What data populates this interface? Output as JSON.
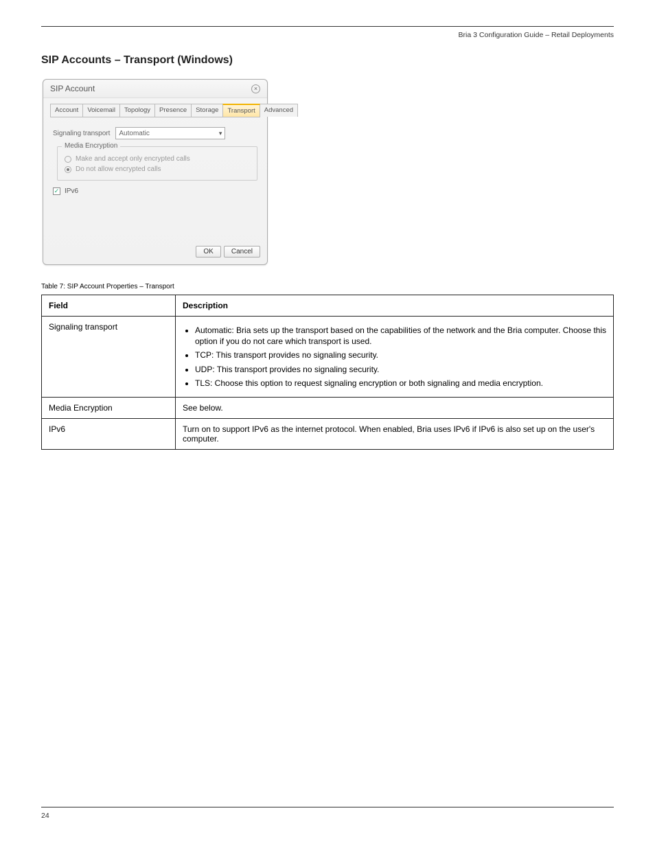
{
  "header": {
    "right": "Bria 3 Configuration Guide – Retail Deployments"
  },
  "section_title": "SIP Accounts – Transport (Windows)",
  "dialog": {
    "title": "SIP Account",
    "close": "×",
    "tabs": [
      "Account",
      "Voicemail",
      "Topology",
      "Presence",
      "Storage",
      "Transport",
      "Advanced"
    ],
    "active_tab_index": 5,
    "signaling_label": "Signaling transport",
    "signaling_value": "Automatic",
    "fieldset_legend": "Media Encryption",
    "radio1": "Make and accept only encrypted calls",
    "radio2": "Do not allow encrypted calls",
    "ipv6_label": "IPv6",
    "ok": "OK",
    "cancel": "Cancel"
  },
  "table": {
    "caption": "Table 7: SIP Account Properties – Transport",
    "h1": "Field",
    "h2": "Description",
    "rows": [
      {
        "field": "Signaling transport",
        "items": [
          "Automatic: Bria sets up the transport based on the capabilities of the network and the Bria computer. Choose this option if you do not care which transport is used.",
          "TCP: This transport provides no signaling security.",
          "UDP: This transport provides no signaling security.",
          "TLS: Choose this option to request signaling encryption or both signaling and media encryption."
        ]
      },
      {
        "field": "Media Encryption",
        "desc": "See below."
      },
      {
        "field": "IPv6",
        "desc": "Turn on to support IPv6 as the internet protocol. When enabled, Bria uses IPv6 if IPv6 is also set up on the user's computer."
      }
    ]
  },
  "footer": {
    "page": "24"
  }
}
